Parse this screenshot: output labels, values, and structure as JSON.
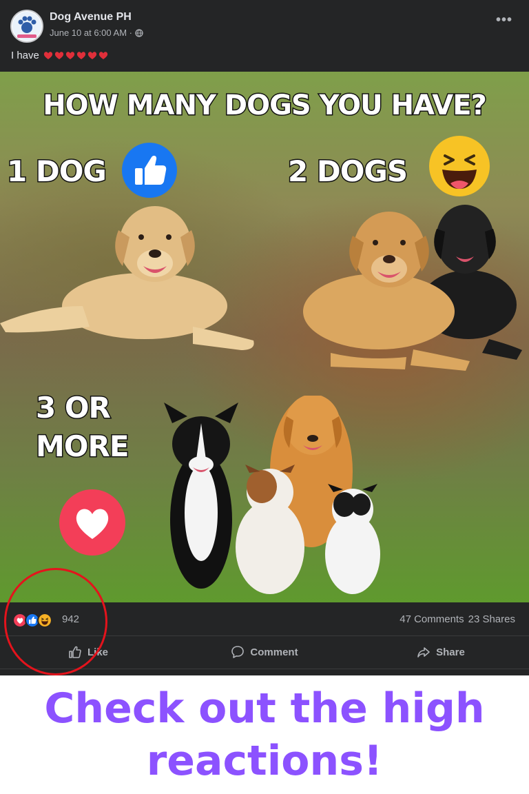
{
  "post": {
    "page_name": "Dog Avenue PH",
    "timestamp": "June 10 at 6:00 AM ·",
    "privacy_icon": "globe-icon",
    "more_label": "•••",
    "caption_text": "I have",
    "caption_hearts": 6
  },
  "image": {
    "title": "HOW MANY DOGS YOU HAVE?",
    "option_1": "1 DOG",
    "option_2": "2 DOGS",
    "option_3": "3 OR MORE",
    "reaction_1": "like-icon",
    "reaction_2": "haha-icon",
    "reaction_3": "love-icon"
  },
  "engagement": {
    "reaction_icons": [
      "love-icon",
      "like-icon",
      "haha-icon"
    ],
    "reaction_count": "942",
    "comments": "47 Comments",
    "shares": "23 Shares"
  },
  "actions": {
    "like": "Like",
    "comment": "Comment",
    "share": "Share"
  },
  "overlay_caption": "Check out the high reactions!",
  "colors": {
    "card_bg": "#242526",
    "caption_purple": "#8c52ff",
    "annotation_red": "#e4131c",
    "like_blue": "#1877f2",
    "love_red": "#f33e58",
    "haha_yellow": "#f7b125"
  }
}
